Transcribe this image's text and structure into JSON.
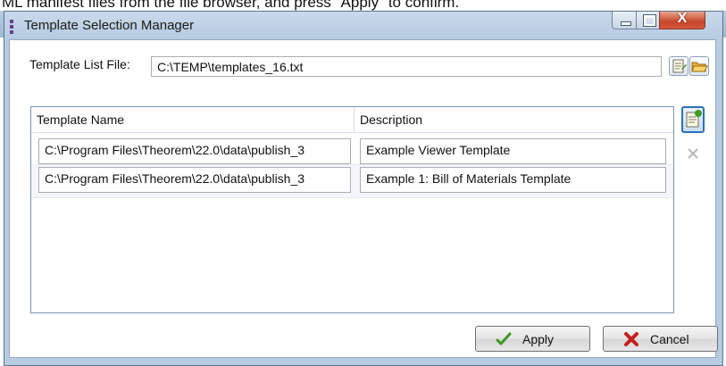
{
  "caption": "ML manifest files from the file browser, and press \"Apply\" to confirm.",
  "window": {
    "title": "Template Selection Manager",
    "close_glyph": "X"
  },
  "file": {
    "label": "Template List File:",
    "value": "C:\\TEMP\\templates_16.txt"
  },
  "grid": {
    "columns": [
      "Template Name",
      "Description"
    ],
    "rows": [
      {
        "name": "C:\\Program Files\\Theorem\\22.0\\data\\publish_3",
        "description": "Example Viewer Template"
      },
      {
        "name": "C:\\Program Files\\Theorem\\22.0\\data\\publish_3",
        "description": "Example 1: Bill of Materials Template"
      }
    ]
  },
  "buttons": {
    "apply": "Apply",
    "cancel": "Cancel"
  },
  "icons": {
    "edit_file": "edit-document-icon",
    "open_folder": "open-folder-icon",
    "add_row": "add-row-icon",
    "delete_row": "delete-x-icon",
    "apply": "checkmark-icon",
    "cancel": "red-x-icon"
  },
  "colors": {
    "titlebar": "#b7cbe1",
    "close_button": "#c5462a",
    "selection_border": "#2e6fb7",
    "apply_check": "#3a9a1e",
    "cancel_x": "#c81e1e"
  }
}
